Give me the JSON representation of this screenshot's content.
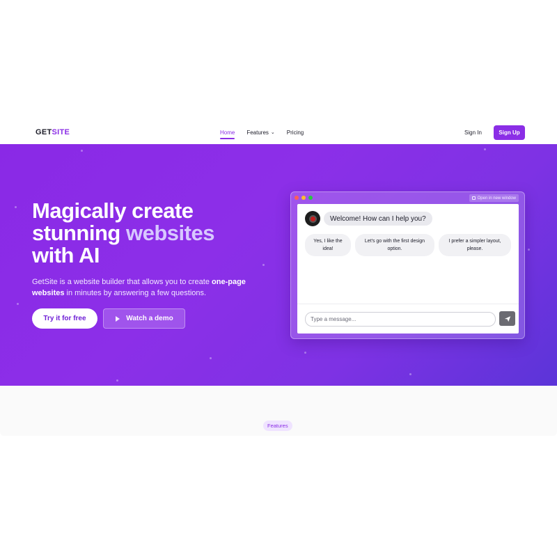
{
  "nav": {
    "logo_prefix": "GET",
    "logo_suffix": "SITE",
    "links": [
      {
        "label": "Home"
      },
      {
        "label": "Features"
      },
      {
        "label": "Pricing"
      }
    ],
    "signin_label": "Sign In",
    "signup_label": "Sign Up"
  },
  "hero": {
    "headline_1": "Magically create",
    "headline_2a": "stunning ",
    "headline_2b": "websites",
    "headline_3": "with AI",
    "sub_1": "GetSite is a website builder that allows you to create ",
    "sub_bold": "one-page websites",
    "sub_2": " in minutes by answering a few questions.",
    "cta_primary": "Try it for free",
    "cta_secondary": "Watch a demo"
  },
  "chat": {
    "open_new_window": "Open in new window",
    "bot_message": "Welcome! How can I help you?",
    "options": [
      {
        "line1": "Yes, I like the",
        "line2": "idea!"
      },
      {
        "line1": "Let's go with the first design",
        "line2": "option."
      },
      {
        "line1": "I prefer a simpler layout,",
        "line2": "please."
      }
    ],
    "input_placeholder": "Type a message..."
  },
  "features": {
    "badge": "Features"
  },
  "colors": {
    "brand": "#8b2ee6",
    "traffic_red": "#ff5f57",
    "traffic_yellow": "#febc2e",
    "traffic_green": "#28c840"
  }
}
